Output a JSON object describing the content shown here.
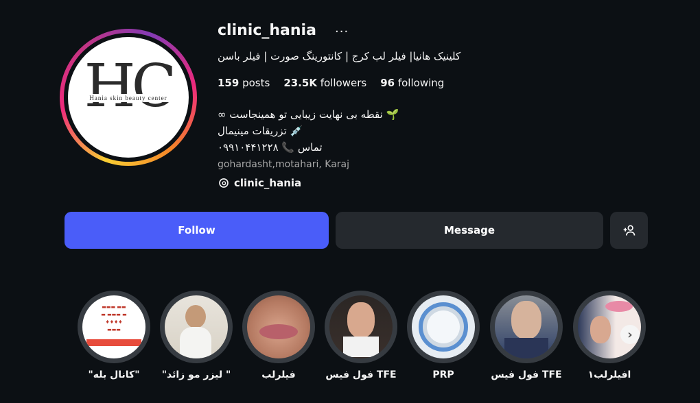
{
  "profile": {
    "username": "clinic_hania",
    "more_icon": "more-horizontal-icon",
    "bio_title": "کلینیک هانیا| فیلر لب کرج | کانتورینگ صورت | فیلر باسن",
    "posts_count": "159",
    "posts_label": "posts",
    "followers_count": "23.5K",
    "followers_label": "followers",
    "following_count": "96",
    "following_label": "following",
    "bio_lines": [
      "∞ نقطه بی نهایت زیبایی تو همینجاست 🌱",
      "تزریقات مینیمال 💉",
      "تماس 📞 ۰۹۹۱۰۴۴۱۲۲۸"
    ],
    "location": "gohardasht,motahari, Karaj",
    "threads_handle": "clinic_hania",
    "avatar": {
      "letters": "HC",
      "subtitle": "Hania skin beauty center"
    }
  },
  "actions": {
    "follow_label": "Follow",
    "message_label": "Message",
    "add_user_icon": "add-user-icon"
  },
  "highlights": [
    {
      "label": "\"کانال بله\""
    },
    {
      "label": "\"لیزر مو زائد \""
    },
    {
      "label": "فیلرلب"
    },
    {
      "label": "فول فیس TFE"
    },
    {
      "label": "PRP"
    },
    {
      "label": "فول فیس TFE"
    },
    {
      "label": "افیلرلب۱"
    }
  ],
  "highlight_nav_icon": "chevron-right-icon"
}
